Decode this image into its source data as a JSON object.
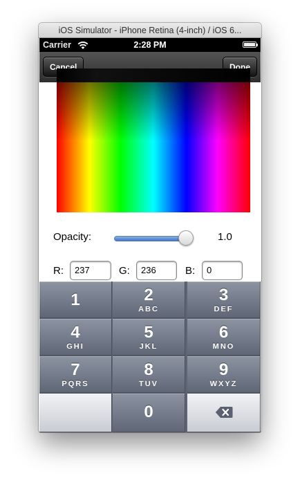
{
  "window": {
    "title": "iOS Simulator - iPhone Retina (4-inch) / iOS 6..."
  },
  "status_bar": {
    "carrier": "Carrier",
    "time": "2:28 PM",
    "icons": [
      "wifi-icon",
      "battery-icon"
    ]
  },
  "nav_bar": {
    "cancel_label": "Cancel",
    "done_label": "Done"
  },
  "opacity": {
    "label": "Opacity:",
    "value": "1.0",
    "slider_level": 1.0
  },
  "rgb": {
    "r_label": "R:",
    "r_value": "237",
    "g_label": "G:",
    "g_value": "236",
    "b_label": "B:",
    "b_value": "0"
  },
  "keypad": {
    "keys": [
      {
        "digit": "1",
        "letters": ""
      },
      {
        "digit": "2",
        "letters": "ABC"
      },
      {
        "digit": "3",
        "letters": "DEF"
      },
      {
        "digit": "4",
        "letters": "GHI"
      },
      {
        "digit": "5",
        "letters": "JKL"
      },
      {
        "digit": "6",
        "letters": "MNO"
      },
      {
        "digit": "7",
        "letters": "PQRS"
      },
      {
        "digit": "8",
        "letters": "TUV"
      },
      {
        "digit": "9",
        "letters": "WXYZ"
      },
      {
        "digit": "0",
        "letters": ""
      }
    ],
    "delete_icon": "delete-backspace-icon"
  },
  "colors": {
    "keypad_bg": "#5d6575",
    "slider_fill": "#3c73c8",
    "navbar": "#1a1a1a"
  }
}
